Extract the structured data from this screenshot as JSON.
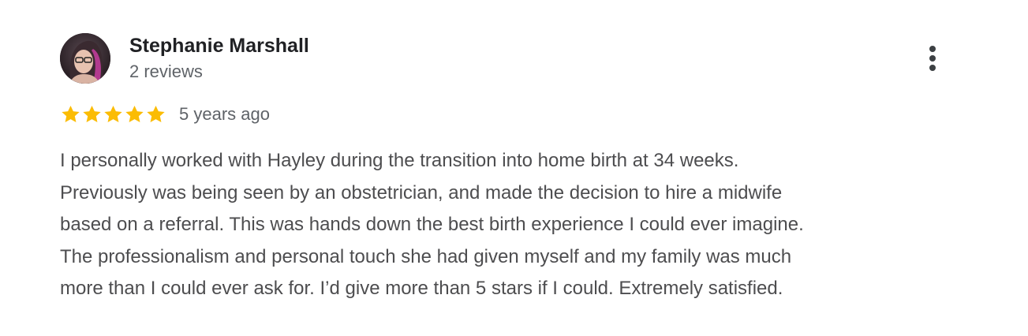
{
  "reviewer": {
    "name": "Stephanie Marshall",
    "review_count": "2 reviews",
    "avatar_icon": "profile-photo"
  },
  "rating": {
    "stars": 5,
    "max_stars": 5,
    "star_color": "#fbbc04",
    "date": "5 years ago"
  },
  "review": {
    "text": "I personally worked with Hayley during the transition into home birth at 34 weeks.\nPreviously was being seen by an obstetrician, and made the decision to hire a midwife\nbased on a referral. This was hands down the best birth experience I could ever imagine.\nThe professionalism and personal touch she had given myself and my family was much\nmore than I could ever ask for. I’d give more than 5 stars if I could. Extremely satisfied."
  },
  "menu": {
    "icon": "more-vert-icon"
  },
  "colors": {
    "name": "#202124",
    "secondary": "#5f6368",
    "body_text": "#4d4d4f",
    "menu_dots": "#3c4043"
  }
}
